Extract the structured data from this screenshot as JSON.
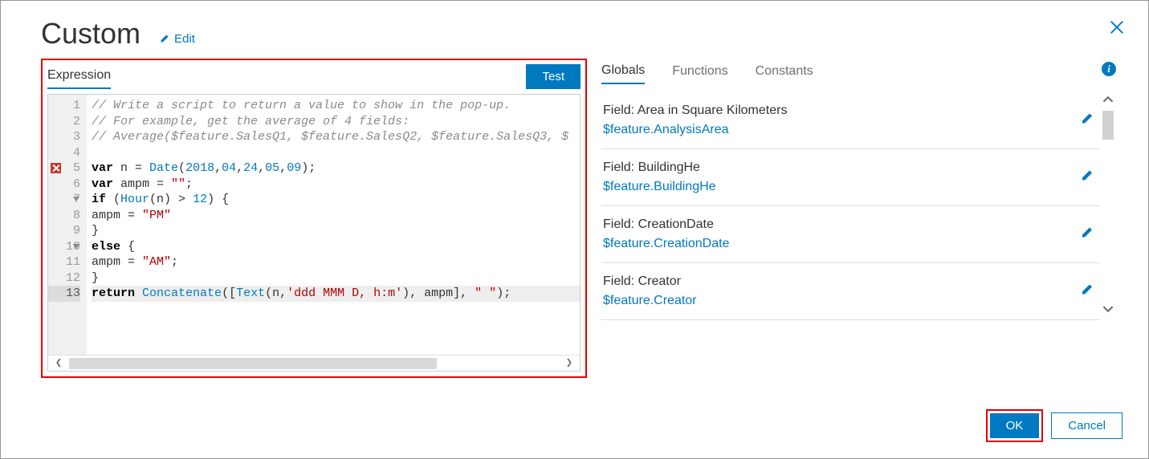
{
  "dialog": {
    "title": "Custom",
    "edit_label": "Edit"
  },
  "left": {
    "tab_expression": "Expression",
    "test_label": "Test",
    "code": [
      {
        "n": 1,
        "tokens": [
          [
            "comment",
            "// Write a script to return a value to show in the pop-up."
          ]
        ]
      },
      {
        "n": 2,
        "tokens": [
          [
            "comment",
            "// For example, get the average of 4 fields:"
          ]
        ]
      },
      {
        "n": 3,
        "tokens": [
          [
            "comment",
            "// Average($feature.SalesQ1, $feature.SalesQ2, $feature.SalesQ3, $"
          ]
        ]
      },
      {
        "n": 4,
        "tokens": []
      },
      {
        "n": 5,
        "err": true,
        "tokens": [
          [
            "kw",
            "var"
          ],
          [
            "p",
            " n = "
          ],
          [
            "fn",
            "Date"
          ],
          [
            "p",
            "("
          ],
          [
            "num",
            "2018"
          ],
          [
            "p",
            ","
          ],
          [
            "num",
            "04"
          ],
          [
            "p",
            ","
          ],
          [
            "num",
            "24"
          ],
          [
            "p",
            ","
          ],
          [
            "num",
            "05"
          ],
          [
            "p",
            ","
          ],
          [
            "num",
            "09"
          ],
          [
            "p",
            ");"
          ]
        ]
      },
      {
        "n": 6,
        "tokens": [
          [
            "kw",
            "var"
          ],
          [
            "p",
            " ampm = "
          ],
          [
            "str",
            "\"\""
          ],
          [
            "p",
            ";"
          ]
        ]
      },
      {
        "n": 7,
        "fold": true,
        "tokens": [
          [
            "kw",
            "if"
          ],
          [
            "p",
            " ("
          ],
          [
            "fn",
            "Hour"
          ],
          [
            "p",
            "(n) > "
          ],
          [
            "num",
            "12"
          ],
          [
            "p",
            ") {"
          ]
        ]
      },
      {
        "n": 8,
        "tokens": [
          [
            "p",
            "ampm = "
          ],
          [
            "str",
            "\"PM\""
          ]
        ]
      },
      {
        "n": 9,
        "tokens": [
          [
            "p",
            "}"
          ]
        ]
      },
      {
        "n": 10,
        "fold": true,
        "tokens": [
          [
            "kw",
            "else"
          ],
          [
            "p",
            " {"
          ]
        ]
      },
      {
        "n": 11,
        "tokens": [
          [
            "p",
            "ampm = "
          ],
          [
            "str",
            "\"AM\""
          ],
          [
            "p",
            ";"
          ]
        ]
      },
      {
        "n": 12,
        "tokens": [
          [
            "p",
            "}"
          ]
        ]
      },
      {
        "n": 13,
        "hl": true,
        "tokens": [
          [
            "kw",
            "return"
          ],
          [
            "p",
            " "
          ],
          [
            "fn",
            "Concatenate"
          ],
          [
            "p",
            "(["
          ],
          [
            "fn",
            "Text"
          ],
          [
            "p",
            "(n,"
          ],
          [
            "str",
            "'ddd MMM D, h:m'"
          ],
          [
            "p",
            ")"
          ],
          [
            "p",
            ", ampm], "
          ],
          [
            "str",
            "\" \""
          ],
          [
            "p",
            ");"
          ]
        ]
      }
    ]
  },
  "right": {
    "tabs": {
      "globals": "Globals",
      "functions": "Functions",
      "constants": "Constants"
    },
    "fields": [
      {
        "label": "Field: Area in Square Kilometers",
        "ref": "$feature.AnalysisArea"
      },
      {
        "label": "Field: BuildingHe",
        "ref": "$feature.BuildingHe"
      },
      {
        "label": "Field: CreationDate",
        "ref": "$feature.CreationDate"
      },
      {
        "label": "Field: Creator",
        "ref": "$feature.Creator"
      }
    ]
  },
  "footer": {
    "ok": "OK",
    "cancel": "Cancel"
  },
  "icons": {
    "info": "i"
  }
}
